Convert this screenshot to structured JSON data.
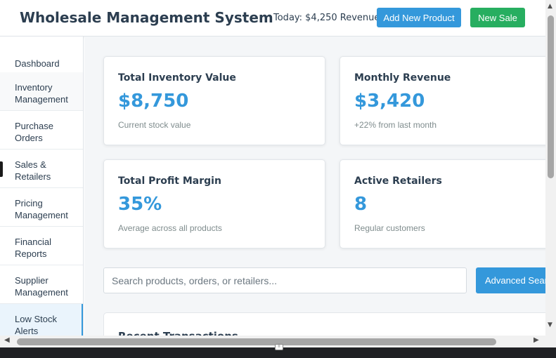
{
  "header": {
    "title": "Wholesale Management System",
    "today": "Today: $4,250 Revenue",
    "add_product_label": "Add New Product",
    "new_sale_label": "New Sale"
  },
  "sidebar": {
    "items": [
      {
        "label": "Dashboard"
      },
      {
        "label": "Inventory Management"
      },
      {
        "label": "Purchase Orders"
      },
      {
        "label": "Sales & Retailers"
      },
      {
        "label": "Pricing Management"
      },
      {
        "label": "Financial Reports"
      },
      {
        "label": "Supplier Management"
      },
      {
        "label": "Low Stock Alerts"
      }
    ]
  },
  "cards": [
    {
      "label": "Total Inventory Value",
      "value": "$8,750",
      "sub": "Current stock value"
    },
    {
      "label": "Monthly Revenue",
      "value": "$3,420",
      "sub": "+22% from last month"
    },
    {
      "label": "Total Profit Margin",
      "value": "35%",
      "sub": "Average across all products"
    },
    {
      "label": "Active Retailers",
      "value": "8",
      "sub": "Regular customers"
    }
  ],
  "search": {
    "placeholder": "Search products, orders, or retailers...",
    "advanced_label": "Advanced Search"
  },
  "recent": {
    "title": "Recent Transactions"
  },
  "colors": {
    "accent": "#3498db",
    "success": "#27ae60",
    "text": "#2c3e50",
    "muted": "#7f8c8d"
  }
}
